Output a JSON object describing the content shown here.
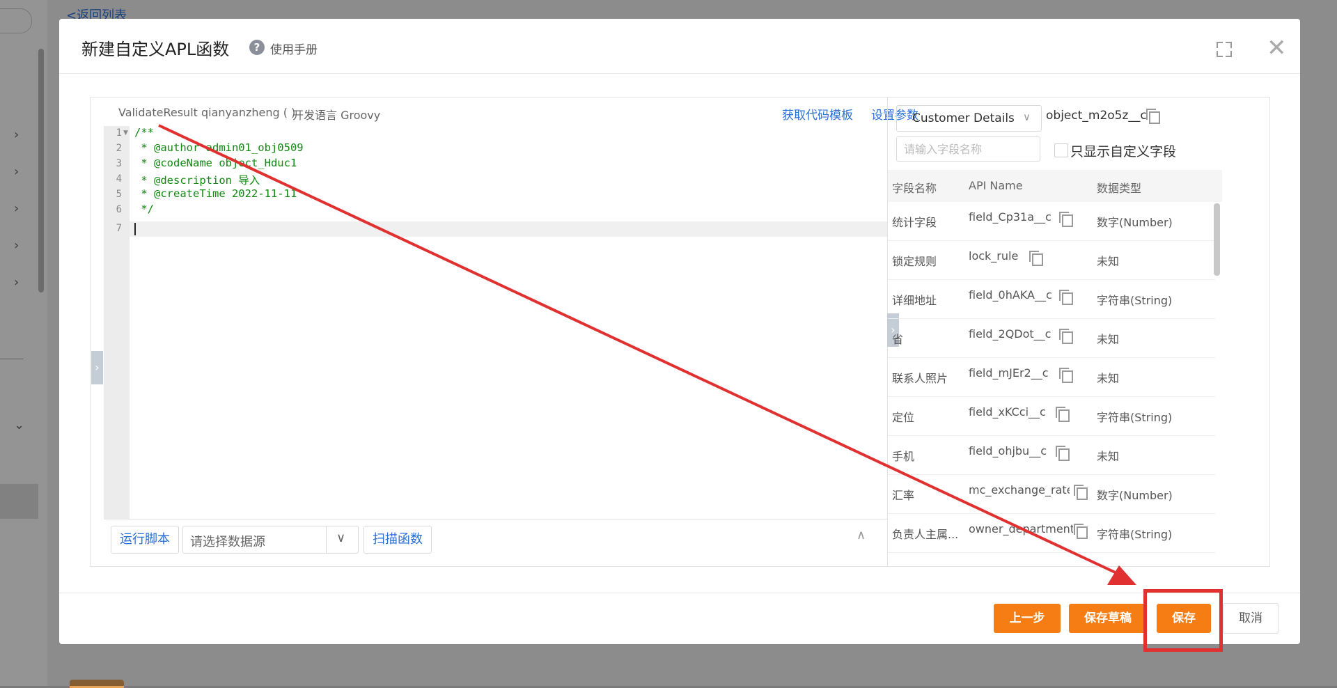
{
  "background": {
    "back_link": "<返回列表"
  },
  "modal": {
    "title": "新建自定义APL函数",
    "help_icon": "question-circle-icon",
    "help_link": "使用手册"
  },
  "editor": {
    "signature": "ValidateResult qianyanzheng ( )",
    "language": "开发语言 Groovy",
    "get_template": "获取代码模板",
    "set_params": "设置参数",
    "line_numbers": [
      "1",
      "2",
      "3",
      "4",
      "5",
      "6",
      "7"
    ],
    "lines": [
      "/**",
      " * @author admin01_obj0509",
      " * @codeName object_Hduc1",
      " * @description 导入",
      " * @createTime 2022-11-11",
      " */",
      ""
    ],
    "run_script": "运行脚本",
    "datasource_placeholder": "请选择数据源",
    "scan_function": "扫描函数"
  },
  "fields_panel": {
    "object_select": "Customer Details",
    "object_api": "object_m2o5z__c",
    "search_placeholder": "请输入字段名称",
    "custom_only_label": "只显示自定义字段",
    "headers": [
      "字段名称",
      "API Name",
      "数据类型"
    ],
    "rows": [
      {
        "name": "统计字段",
        "api": "field_Cp31a__c",
        "type": "数字(Number)"
      },
      {
        "name": "锁定规则",
        "api": "lock_rule",
        "type": "未知"
      },
      {
        "name": "详细地址",
        "api": "field_0hAKA__c",
        "type": "字符串(String)"
      },
      {
        "name": "省",
        "api": "field_2QDot__c",
        "type": "未知"
      },
      {
        "name": "联系人照片",
        "api": "field_mJEr2__c",
        "type": "未知"
      },
      {
        "name": "定位",
        "api": "field_xKCci__c",
        "type": "字符串(String)"
      },
      {
        "name": "手机",
        "api": "field_ohjbu__c",
        "type": "未知"
      },
      {
        "name": "汇率",
        "api": "mc_exchange_rate",
        "type": "数字(Number)"
      },
      {
        "name": "负责人主属...",
        "api": "owner_department",
        "type": "字符串(String)"
      }
    ]
  },
  "footer": {
    "prev": "上一步",
    "save_draft": "保存草稿",
    "save": "保存",
    "cancel": "取消"
  },
  "colors": {
    "accent_orange": "#f67d14",
    "link_blue": "#2a6fd6",
    "annotation_red": "#e03030"
  }
}
